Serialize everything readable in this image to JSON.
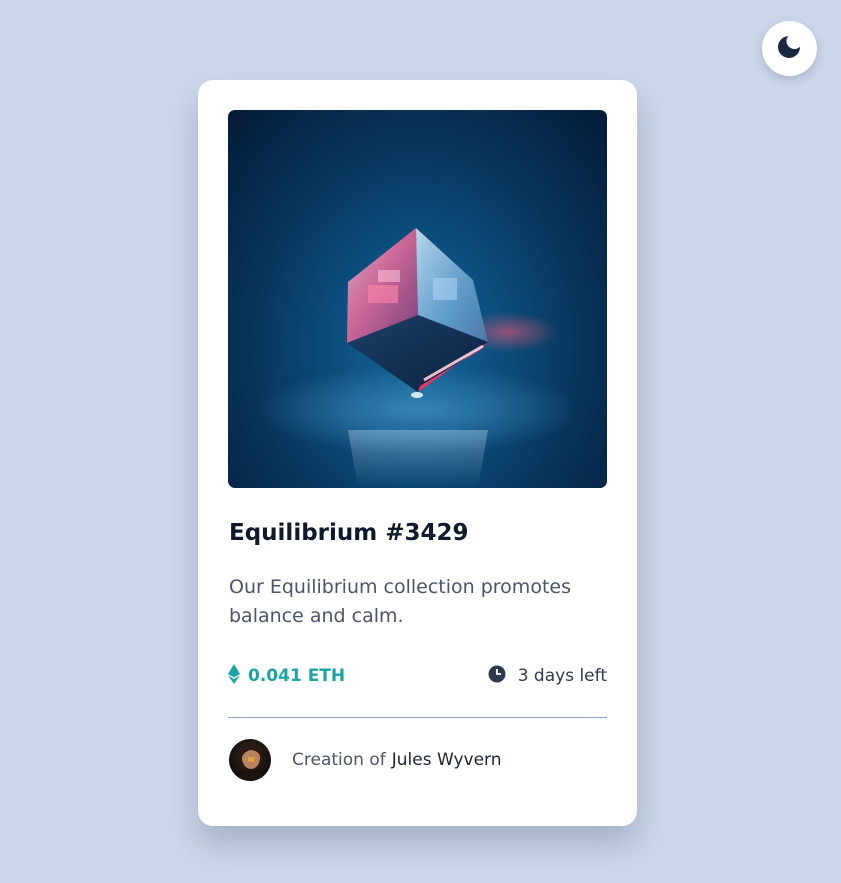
{
  "theme_toggle": {
    "icon": "moon-icon"
  },
  "card": {
    "image": {
      "subject": "glass-cube"
    },
    "title": "Equilibrium #3429",
    "description": "Our Equilibrium collection promotes balance and calm.",
    "price": {
      "icon": "ethereum-icon",
      "value": "0.041 ETH"
    },
    "time_left": {
      "icon": "clock-icon",
      "value": "3 days left"
    },
    "creator": {
      "avatar_icon": "avatar",
      "prefix": "Creation of",
      "name": "Jules Wyvern"
    }
  },
  "colors": {
    "background": "#cbd6e8",
    "card": "#ffffff",
    "accent": "#1aa5a0",
    "title": "#0e1a2c",
    "body_text": "#4a5569",
    "divider": "#8ea6c2",
    "toggle_icon": "#1a2840"
  }
}
